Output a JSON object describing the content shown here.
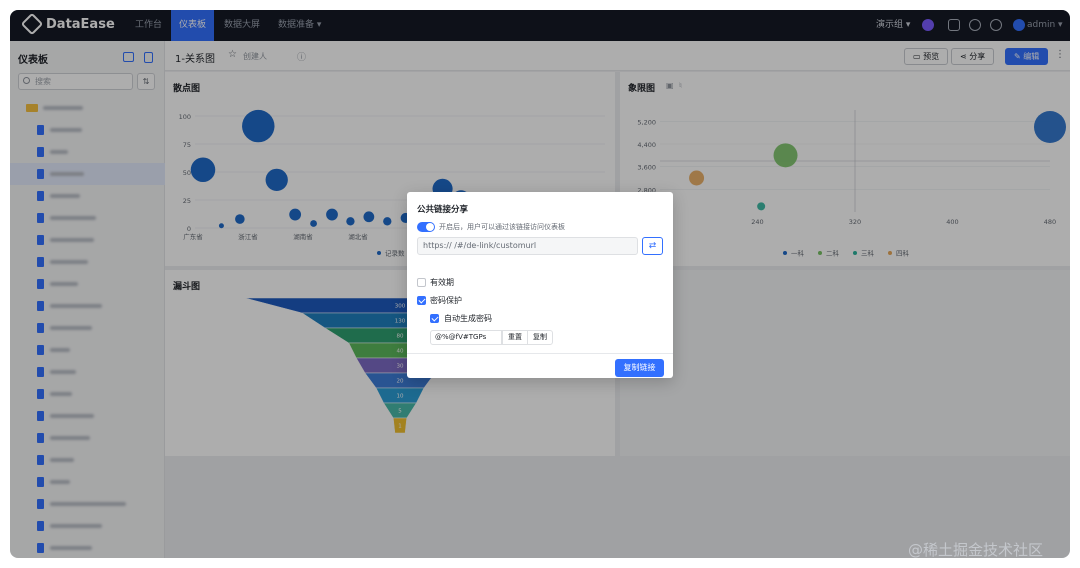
{
  "app": {
    "brand": "DataEase"
  },
  "topnav": {
    "items": [
      "工作台",
      "仪表板",
      "数据大屏",
      "数据准备 ▾"
    ],
    "right_label": "演示组 ▾",
    "user_label": "admin ▾"
  },
  "sidebar": {
    "title": "仪表板",
    "search_placeholder": "搜索",
    "sort_label": "⇅"
  },
  "dashboard": {
    "title": "1-关系图",
    "meta": "创建人",
    "buttons": {
      "preview": "预览",
      "share": "分享",
      "edit": "编辑"
    }
  },
  "cards": {
    "scatter": {
      "title": "散点图",
      "legend": "记录数"
    },
    "quadrant": {
      "title": "象限图",
      "legend": [
        "一科",
        "二科",
        "三科",
        "四科"
      ]
    },
    "funnel": {
      "title": "漏斗图"
    }
  },
  "chart_data": [
    {
      "type": "scatter",
      "title": "散点图",
      "ylim": [
        0,
        100
      ],
      "y_ticks": [
        0,
        25,
        50,
        75,
        100
      ],
      "x_tick_labels": [
        "广东省",
        "浙江省",
        "湖南省",
        "湖北省"
      ],
      "series": [
        {
          "name": "记录数",
          "values": [
            52,
            2,
            8,
            91,
            43,
            12,
            4,
            12,
            6,
            10,
            6,
            9,
            9,
            35,
            26
          ]
        }
      ]
    },
    {
      "type": "scatter",
      "title": "象限图",
      "x_ticks": [
        240,
        320,
        400,
        480
      ],
      "y_ticks": [
        2800,
        3600,
        4400,
        5200
      ],
      "points": [
        {
          "series": "四科",
          "x": 190,
          "y": 3200
        },
        {
          "series": "三科",
          "x": 243,
          "y": 2200
        },
        {
          "series": "二科",
          "x": 263,
          "y": 4000
        },
        {
          "series": "一科",
          "x": 480,
          "y": 5000
        }
      ]
    },
    {
      "type": "funnel",
      "title": "漏斗图",
      "values": [
        300,
        130,
        80,
        40,
        30,
        20,
        10,
        5,
        1
      ]
    }
  ],
  "colors": {
    "primary": "#3370ff",
    "topbar": "#151a26",
    "scatter_bubble": "#1f6ac9",
    "funnel": [
      "#1e5bbf",
      "#1f7fbf",
      "#2fa070",
      "#5cb85c",
      "#7d6bc5",
      "#3d7dd8",
      "#2c9cd4",
      "#47b8a8",
      "#f0c030"
    ],
    "quadrant": [
      "#1f6ac9",
      "#78c265",
      "#2bb39c",
      "#e8a95a"
    ]
  },
  "dialog": {
    "title": "公共链接分享",
    "switch_label": "开启后，用户可以通过该链接访问仪表板",
    "url": "https://                /#/de-link/customurl",
    "refresh_icon": "⇄",
    "expiry_label": "有效期",
    "password_label": "密码保护",
    "auto_password_label": "自动生成密码",
    "password_value": "@%@fV#TGPs",
    "reset_label": "重置",
    "copy_label": "复制",
    "copy_link_label": "复制链接"
  },
  "watermark": "@稀土掘金技术社区"
}
